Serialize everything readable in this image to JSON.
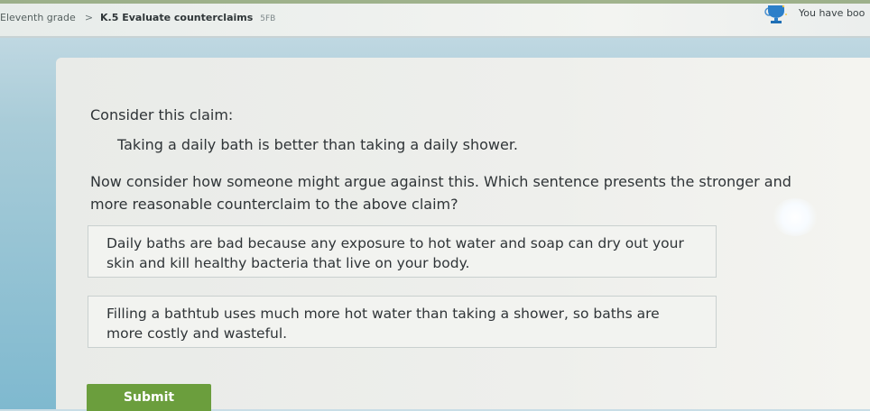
{
  "breadcrumb": {
    "grade": "Eleventh grade",
    "separator": ">",
    "skill": "K.5 Evaluate counterclaims",
    "code": "5FB"
  },
  "award": {
    "text": "You have boo",
    "icon": "trophy-icon"
  },
  "question": {
    "prompt": "Consider this claim:",
    "claim": "Taking a daily bath is better than taking a daily shower.",
    "instruction": "Now consider how someone might argue against this. Which sentence presents the stronger and more reasonable counterclaim to the above claim?"
  },
  "options": [
    {
      "text": "Daily baths are bad because any exposure to hot water and soap can dry out your skin and kill healthy bacteria that live on your body."
    },
    {
      "text": "Filling a bathtub uses much more hot water than taking a shower, so baths are more costly and wasteful."
    }
  ],
  "submit": {
    "label": "Submit"
  },
  "colors": {
    "submit": "#6b9e3d",
    "card": "#eeefec",
    "background": "#7fb9cf",
    "topbar": "#f0f2ef"
  }
}
